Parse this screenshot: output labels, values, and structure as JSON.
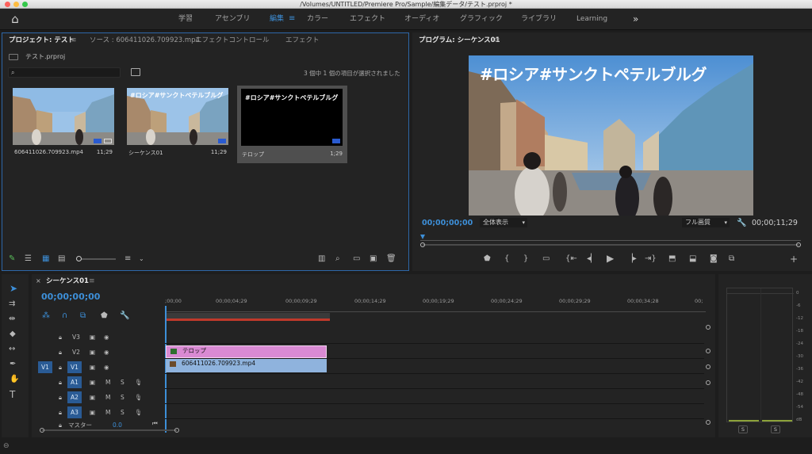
{
  "window": {
    "title": "/Volumes/UNTITLED/Premiere Pro/Sample/編集データ/テスト.prproj *"
  },
  "workspaces": [
    {
      "label": "学習",
      "active": false
    },
    {
      "label": "アセンブリ",
      "active": false
    },
    {
      "label": "編集",
      "active": true
    },
    {
      "label": "カラー",
      "active": false
    },
    {
      "label": "エフェクト",
      "active": false
    },
    {
      "label": "オーディオ",
      "active": false
    },
    {
      "label": "グラフィック",
      "active": false
    },
    {
      "label": "ライブラリ",
      "active": false
    },
    {
      "label": "Learning",
      "active": false
    }
  ],
  "project_panel": {
    "tabs": [
      "プロジェクト: テスト",
      "ソース : 606411026.709923.mp4",
      "エフェクトコントロール",
      "エフェクト"
    ],
    "file": "テスト.prproj",
    "selection_status": "3 個中 1 個の項目が選択されました",
    "items": [
      {
        "name": "606411026.709923.mp4",
        "duration": "11;29",
        "kind": "video"
      },
      {
        "name": "シーケンス01",
        "duration": "11;29",
        "kind": "sequence"
      },
      {
        "name": "テロップ",
        "duration": "1;29",
        "kind": "title",
        "selected": true
      }
    ]
  },
  "program_monitor": {
    "title": "プログラム: シーケンス01",
    "overlay_text": "#ロシア#サンクトペテルブルグ",
    "current_timecode": "00;00;00;00",
    "zoom": "全体表示",
    "quality": "フル画質",
    "duration_timecode": "00;00;11;29"
  },
  "timeline": {
    "sequence_tab": "シーケンス01",
    "current_timecode": "00;00;00;00",
    "ruler_labels": [
      ";00;00",
      "00;00;04;29",
      "00;00;09;29",
      "00;00;14;29",
      "00;00;19;29",
      "00;00;24;29",
      "00;00;29;29",
      "00;00;34;28",
      "00;"
    ],
    "video_tracks": [
      {
        "name": "V3",
        "target": ""
      },
      {
        "name": "V2",
        "target": ""
      },
      {
        "name": "V1",
        "target": "V1"
      }
    ],
    "audio_tracks": [
      {
        "name": "A1",
        "m": "M",
        "s": "S"
      },
      {
        "name": "A2",
        "m": "M",
        "s": "S"
      },
      {
        "name": "A3",
        "m": "M",
        "s": "S"
      }
    ],
    "master_label": "マスター",
    "master_value": "0.0",
    "clips": [
      {
        "label": "テロップ",
        "track": "V2",
        "color": "#d98ad3"
      },
      {
        "label": "606411026.709923.mp4",
        "track": "V1",
        "color": "#8fb3dd"
      }
    ]
  },
  "audio_meter": {
    "scale": [
      "0",
      "-6",
      "-12",
      "-18",
      "-24",
      "-30",
      "-36",
      "-42",
      "-48",
      "-54",
      "dB"
    ],
    "solo_labels": [
      "S",
      "S"
    ]
  },
  "colors": {
    "accent": "#3d8fd8",
    "panel": "#232323",
    "focus_border": "#2d67a8",
    "title_clip": "#d98ad3",
    "video_clip": "#8fb3dd"
  }
}
